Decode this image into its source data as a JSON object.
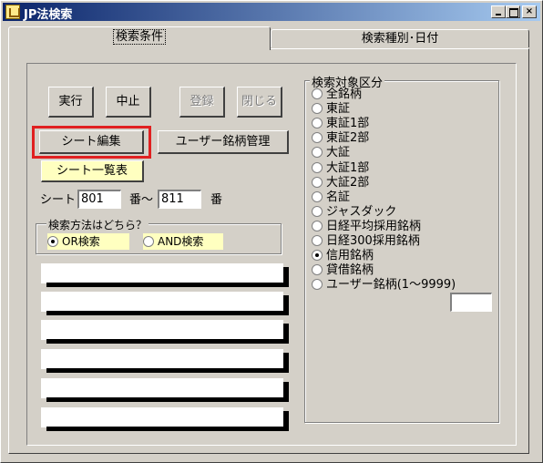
{
  "window": {
    "title": "JP法検索",
    "controls": {
      "minimize": "_",
      "maximize": "□",
      "close": "×"
    }
  },
  "tabs": [
    {
      "label": "検索条件",
      "active": true
    },
    {
      "label": "検索種別･日付",
      "active": false
    }
  ],
  "toolbar": {
    "run": "実行",
    "stop": "中止",
    "register": "登録",
    "close": "閉じる"
  },
  "sheet": {
    "edit_button": "シート編集",
    "user_stock_button": "ユーザー銘柄管理",
    "list_button": "シート一覧表",
    "label": "シート",
    "from_value": "801",
    "between_label": "番〜",
    "to_value": "811",
    "suffix_label": "番"
  },
  "search_method": {
    "title": "検索方法はどちら？",
    "options": [
      {
        "label": "OR検索",
        "checked": true
      },
      {
        "label": "AND検索",
        "checked": false
      }
    ]
  },
  "result_rows": [
    "",
    "",
    "",
    "",
    "",
    ""
  ],
  "search_target": {
    "title": "検索対象区分",
    "options": [
      {
        "label": "全銘柄",
        "checked": false
      },
      {
        "label": "東証",
        "checked": false
      },
      {
        "label": "東証1部",
        "checked": false
      },
      {
        "label": "東証2部",
        "checked": false
      },
      {
        "label": "大証",
        "checked": false
      },
      {
        "label": "大証1部",
        "checked": false
      },
      {
        "label": "大証2部",
        "checked": false
      },
      {
        "label": "名証",
        "checked": false
      },
      {
        "label": "ジャスダック",
        "checked": false
      },
      {
        "label": "日経平均採用銘柄",
        "checked": false
      },
      {
        "label": "日経300採用銘柄",
        "checked": false
      },
      {
        "label": "信用銘柄",
        "checked": true
      },
      {
        "label": "貸借銘柄",
        "checked": false
      },
      {
        "label": "ユーザー銘柄(1〜9999)",
        "checked": false
      }
    ],
    "user_code_value": ""
  },
  "colors": {
    "titlebar_start": "#0a246a",
    "titlebar_end": "#a6caf0",
    "face": "#d4d0c8",
    "highlight_red": "#e02020",
    "pill_yellow": "#ffffc0"
  }
}
